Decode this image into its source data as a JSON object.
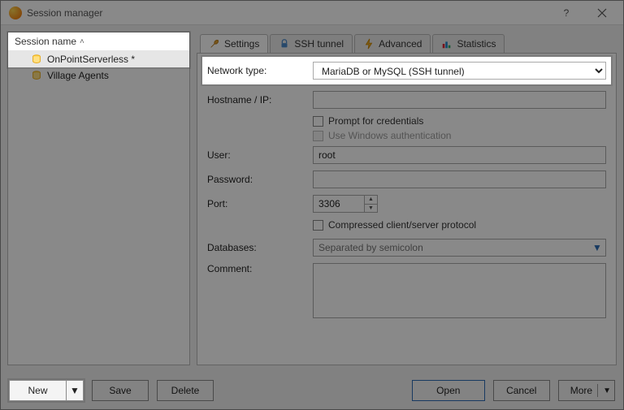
{
  "window": {
    "title": "Session manager"
  },
  "sidebar": {
    "header": "Session name",
    "items": [
      {
        "label": "OnPointServerless *",
        "selected": true
      },
      {
        "label": "Village Agents",
        "selected": false
      }
    ]
  },
  "tabs": [
    {
      "label": "Settings",
      "active": true
    },
    {
      "label": "SSH tunnel",
      "active": false
    },
    {
      "label": "Advanced",
      "active": false
    },
    {
      "label": "Statistics",
      "active": false
    }
  ],
  "form": {
    "network_type_label": "Network type:",
    "network_type_value": "MariaDB or MySQL (SSH tunnel)",
    "hostname_label": "Hostname / IP:",
    "hostname_value": "",
    "prompt_creds_label": "Prompt for credentials",
    "winauth_label": "Use Windows authentication",
    "user_label": "User:",
    "user_value": "root",
    "password_label": "Password:",
    "password_value": "",
    "port_label": "Port:",
    "port_value": "3306",
    "compressed_label": "Compressed client/server protocol",
    "databases_label": "Databases:",
    "databases_placeholder": "Separated by semicolon",
    "comment_label": "Comment:",
    "comment_value": ""
  },
  "footer": {
    "new": "New",
    "save": "Save",
    "delete": "Delete",
    "open": "Open",
    "cancel": "Cancel",
    "more": "More"
  }
}
